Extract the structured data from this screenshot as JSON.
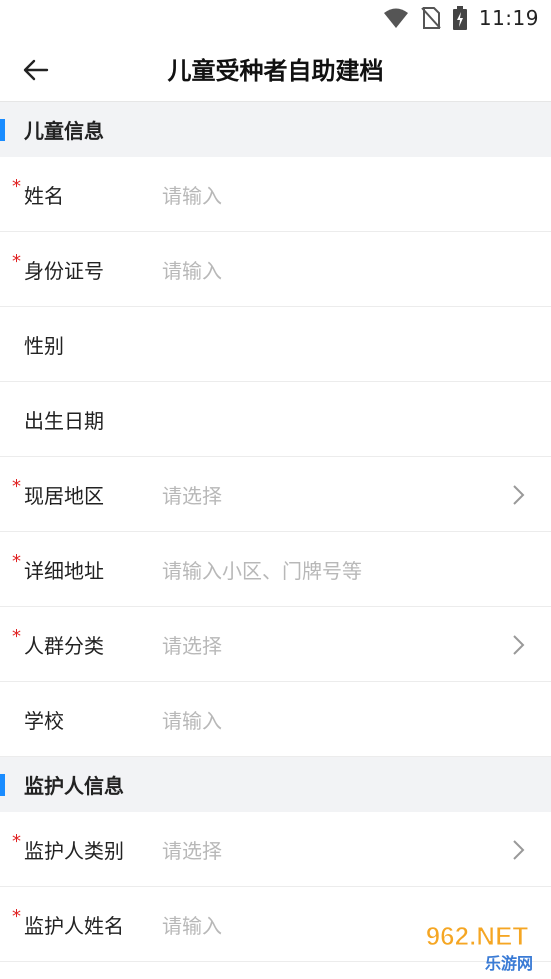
{
  "status_bar": {
    "time": "11:19"
  },
  "app_bar": {
    "title": "儿童受种者自助建档"
  },
  "sections": [
    {
      "title": "儿童信息",
      "rows": [
        {
          "label": "姓名",
          "required": true,
          "placeholder": "请输入",
          "chevron": false
        },
        {
          "label": "身份证号",
          "required": true,
          "placeholder": "请输入",
          "chevron": false
        },
        {
          "label": "性别",
          "required": false,
          "placeholder": "",
          "chevron": false
        },
        {
          "label": "出生日期",
          "required": false,
          "placeholder": "",
          "chevron": false
        },
        {
          "label": "现居地区",
          "required": true,
          "placeholder": "请选择",
          "chevron": true
        },
        {
          "label": "详细地址",
          "required": true,
          "placeholder": "请输入小区、门牌号等",
          "chevron": false
        },
        {
          "label": "人群分类",
          "required": true,
          "placeholder": "请选择",
          "chevron": true
        },
        {
          "label": "学校",
          "required": false,
          "placeholder": "请输入",
          "chevron": false
        }
      ]
    },
    {
      "title": "监护人信息",
      "rows": [
        {
          "label": "监护人类别",
          "required": true,
          "placeholder": "请选择",
          "chevron": true
        },
        {
          "label": "监护人姓名",
          "required": true,
          "placeholder": "请输入",
          "chevron": false
        }
      ]
    }
  ],
  "required_mark": "*",
  "watermark": {
    "main": "962.NET",
    "sub": "乐游网"
  },
  "colors": {
    "accent": "#1a8cff",
    "required": "#e02020",
    "placeholder": "#b8b8b8",
    "section_bg": "#f2f3f5"
  }
}
